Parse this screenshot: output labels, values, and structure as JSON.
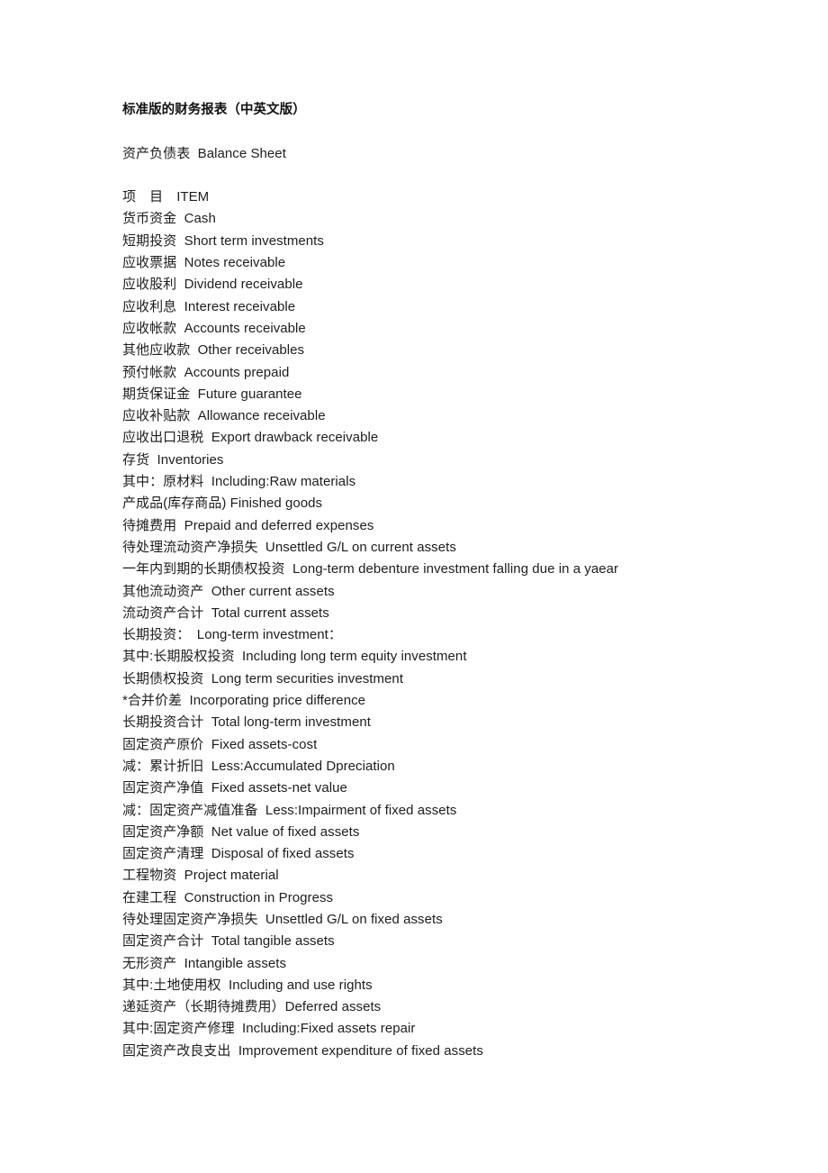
{
  "document": {
    "title": "标准版的财务报表（中英文版）",
    "section_heading": "资产负债表  Balance Sheet",
    "column_header": "项　目　ITEM",
    "lines": [
      "货币资金  Cash",
      "短期投资  Short term investments",
      "应收票据  Notes receivable",
      "应收股利  Dividend receivable",
      "应收利息  Interest receivable",
      "应收帐款  Accounts receivable",
      "其他应收款  Other receivables",
      "预付帐款  Accounts prepaid",
      "期货保证金  Future guarantee",
      "应收补贴款  Allowance receivable",
      "应收出口退税  Export drawback receivable",
      "存货  Inventories",
      "其中：原材料  Including:Raw materials",
      "产成品(库存商品) Finished goods",
      "待摊费用  Prepaid and deferred expenses",
      "待处理流动资产净损失  Unsettled G/L on current assets",
      "一年内到期的长期债权投资  Long-term debenture investment falling due in a yaear",
      "其他流动资产  Other current assets",
      "流动资产合计  Total current assets",
      "长期投资：　Long-term investment：",
      "其中:长期股权投资  Including long term equity investment",
      "长期债权投资  Long term securities investment",
      "*合并价差  Incorporating price difference",
      "长期投资合计  Total long-term investment",
      "固定资产原价  Fixed assets-cost",
      "减：累计折旧  Less:Accumulated Dpreciation",
      "固定资产净值  Fixed assets-net value",
      "减：固定资产减值准备  Less:Impairment of fixed assets",
      "固定资产净额  Net value of fixed assets",
      "固定资产清理  Disposal of fixed assets",
      "工程物资  Project material",
      "在建工程  Construction in Progress",
      "待处理固定资产净损失  Unsettled G/L on fixed assets",
      "固定资产合计  Total tangible assets",
      "无形资产  Intangible assets",
      "其中:土地使用权  Including and use rights",
      "递延资产（长期待摊费用）Deferred assets",
      "其中:固定资产修理  Including:Fixed assets repair",
      "固定资产改良支出  Improvement expenditure of fixed assets"
    ]
  },
  "style": {
    "text_color": "#1d1d1d",
    "background_color": "#ffffff"
  }
}
